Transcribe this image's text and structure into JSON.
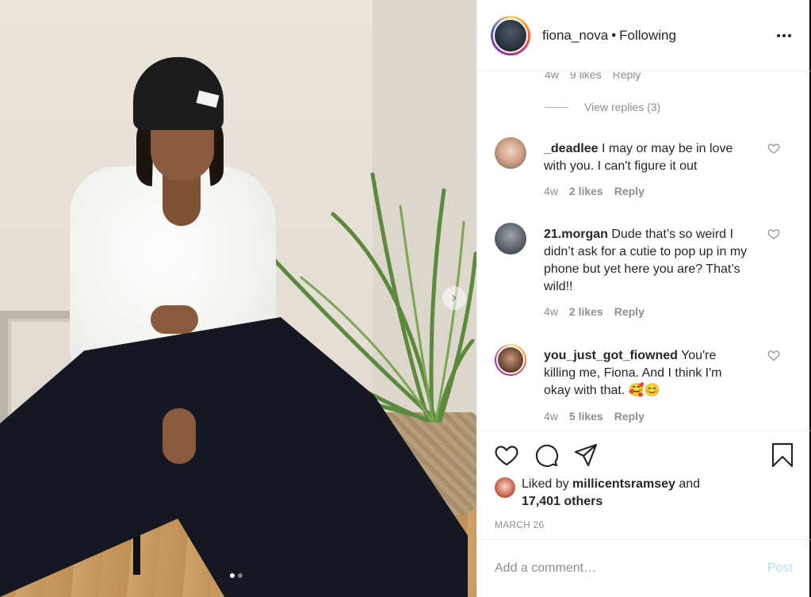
{
  "post": {
    "username": "fiona_nova",
    "separator": "•",
    "follow_status": "Following",
    "more_icon": "more-horizontal-icon"
  },
  "photo": {
    "next_icon": "chevron-right-icon",
    "slide_count": 2,
    "active_slide": 1
  },
  "previous_comment": {
    "time": "4w",
    "likes": "9 likes",
    "reply": "Reply"
  },
  "view_replies": "View replies (3)",
  "comments": [
    {
      "username": "_deadlee",
      "text": "I may or may be in love with you. I can't figure it out",
      "time": "4w",
      "likes": "2 likes",
      "reply": "Reply"
    },
    {
      "username": "21.morgan",
      "text": "Dude that’s so weird I didn’t ask for a cutie to pop up in my phone but yet here you are? That’s wild!!",
      "time": "4w",
      "likes": "2 likes",
      "reply": "Reply"
    },
    {
      "username": "you_just_got_fiowned",
      "text": "You're killing me, Fiona. And I think I'm okay with that. 🥰😊",
      "time": "4w",
      "likes": "5 likes",
      "reply": "Reply"
    }
  ],
  "likes": {
    "prefix": "Liked by",
    "user": "millicentsramsey",
    "and": "and",
    "others": "17,401 others"
  },
  "date": "MARCH 26",
  "add_comment": {
    "placeholder": "Add a comment…",
    "post_label": "Post"
  },
  "colors": {
    "post_button_disabled": "#b3dbff",
    "meta_gray": "#8e8e8e",
    "text": "#262626"
  }
}
